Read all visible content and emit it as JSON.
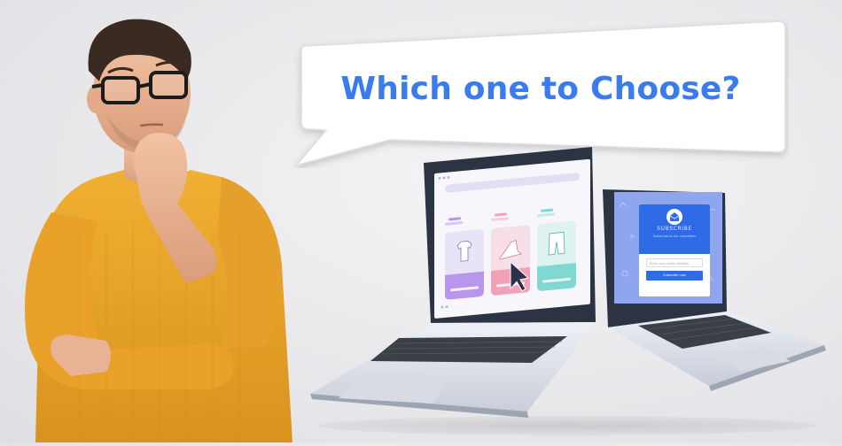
{
  "bubble": {
    "question": "Which one to Choose?"
  },
  "popup_preview": {
    "title": "SUBSCRIBE",
    "subtitle": "Subscribe to our newsletter",
    "email_placeholder": "Enter your email address",
    "button_label": "Subscribe now"
  },
  "colors": {
    "accent_blue": "#3a7bf0",
    "sweater": "#e9a62a",
    "card_purple": "#b896ee",
    "card_pink": "#f1a1b8",
    "card_teal": "#7fd8d2",
    "popup_blue": "#2e6be6"
  }
}
